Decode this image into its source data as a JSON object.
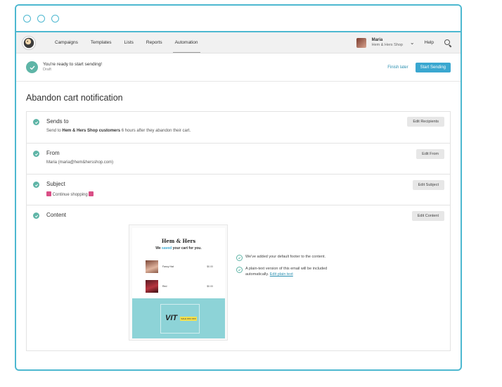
{
  "nav": {
    "items": [
      {
        "label": "Campaigns"
      },
      {
        "label": "Templates"
      },
      {
        "label": "Lists"
      },
      {
        "label": "Reports"
      },
      {
        "label": "Automation"
      }
    ],
    "user_name": "Maria",
    "user_org": "Hem & Hers Shop",
    "help": "Help"
  },
  "ready": {
    "title": "You're ready to start sending!",
    "status": "Draft",
    "finish_later": "Finish later",
    "start_sending": "Start Sending"
  },
  "page_title": "Abandon cart notification",
  "sections": {
    "sends_to": {
      "title": "Sends to",
      "desc_prefix": "Send to",
      "desc_audience": "Hem & Hers Shop customers",
      "desc_suffix": "6 hours after they abandon their cart.",
      "button": "Edit Recipients"
    },
    "from": {
      "title": "From",
      "desc": "Maria (maria@hem&hersshop.com)",
      "button": "Edit From"
    },
    "subject": {
      "title": "Subject",
      "desc": "Continue shopping",
      "button": "Edit Subject"
    },
    "content": {
      "title": "Content",
      "button": "Edit Content",
      "preview": {
        "brand": "Hem & Hers",
        "tag_prefix": "We",
        "tag_highlight": "saved",
        "tag_suffix": "your cart for you.",
        "items": [
          {
            "name": "Fancy Hat",
            "price": "$0.00"
          },
          {
            "name": "Red",
            "price": "$0.00"
          }
        ],
        "banner_text": "VIT",
        "banner_tag": "SALE 15% OFF"
      },
      "notes": {
        "footer": "We've added your default footer to the content.",
        "plaintext": "A plain-text version of this email will be included automatically.",
        "plaintext_link": "Edit plain text"
      }
    }
  },
  "colors": {
    "accent": "#4db8d0",
    "check": "#5fb5a7",
    "button_primary": "#3aa7d0",
    "link": "#2a8fb0"
  }
}
